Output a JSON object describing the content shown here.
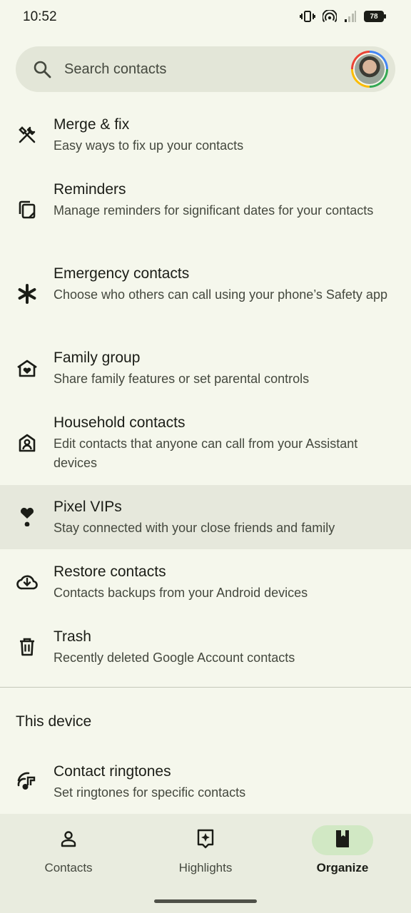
{
  "status_bar": {
    "time": "10:52",
    "battery": "78"
  },
  "search": {
    "placeholder": "Search contacts"
  },
  "items": [
    {
      "title": "Merge & fix",
      "subtitle": "Easy ways to fix up your contacts",
      "icon": "wrench-hammer-icon"
    },
    {
      "title": "Reminders",
      "subtitle": "Manage reminders for significant dates for your contacts",
      "icon": "reminders-icon"
    },
    {
      "title": "Emergency contacts",
      "subtitle": "Choose who others can call using your phone’s Safety app",
      "icon": "asterisk-icon"
    },
    {
      "title": "Family group",
      "subtitle": "Share family features or set parental controls",
      "icon": "home-heart-icon"
    },
    {
      "title": "Household contacts",
      "subtitle": "Edit contacts that anyone can call from your Assistant devices",
      "icon": "home-person-icon"
    },
    {
      "title": "Pixel VIPs",
      "subtitle": "Stay connected with your close friends and family",
      "icon": "heart-dot-icon"
    },
    {
      "title": "Restore contacts",
      "subtitle": "Contacts backups from your Android devices",
      "icon": "cloud-restore-icon"
    },
    {
      "title": "Trash",
      "subtitle": "Recently deleted Google Account contacts",
      "icon": "trash-icon"
    }
  ],
  "section_this_device": "This device",
  "device_items": [
    {
      "title": "Contact ringtones",
      "subtitle": "Set ringtones for specific contacts",
      "icon": "ringtone-icon"
    }
  ],
  "nav": [
    {
      "label": "Contacts",
      "icon": "person-icon",
      "active": false
    },
    {
      "label": "Highlights",
      "icon": "sparkle-icon",
      "active": false
    },
    {
      "label": "Organize",
      "icon": "bookmark-book-icon",
      "active": true
    }
  ],
  "colors": {
    "background": "#f5f7ec",
    "search_bg": "#e3e6d8",
    "highlight_bg": "#e6e8dc",
    "active_pill": "#d1e8c4"
  }
}
